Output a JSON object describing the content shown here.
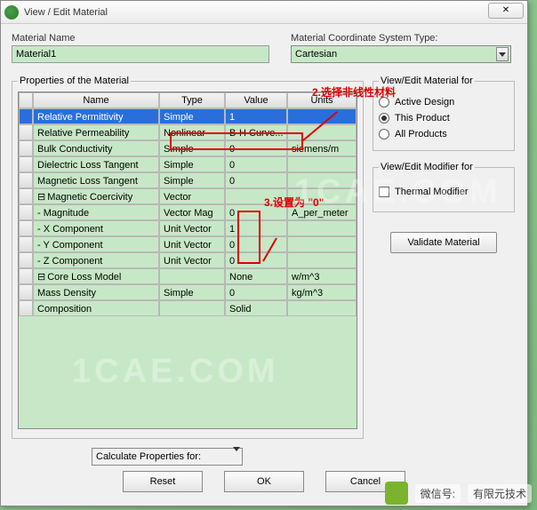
{
  "window": {
    "title": "View / Edit Material",
    "close": "✕"
  },
  "material_name": {
    "label": "Material Name",
    "value": "Material1"
  },
  "coord": {
    "label": "Material Coordinate System Type:",
    "value": "Cartesian"
  },
  "props": {
    "legend": "Properties of the Material",
    "headers": {
      "name": "Name",
      "type": "Type",
      "value": "Value",
      "units": "Units"
    },
    "rows": [
      {
        "name": "Relative Permittivity",
        "type": "Simple",
        "value": "1",
        "units": "",
        "selected": true
      },
      {
        "name": "Relative Permeability",
        "type": "Nonlinear",
        "value": "B-H Curve...",
        "units": ""
      },
      {
        "name": "Bulk Conductivity",
        "type": "Simple",
        "value": "0",
        "units": "siemens/m"
      },
      {
        "name": "Dielectric Loss Tangent",
        "type": "Simple",
        "value": "0",
        "units": ""
      },
      {
        "name": "Magnetic Loss Tangent",
        "type": "Simple",
        "value": "0",
        "units": ""
      },
      {
        "name": "Magnetic Coercivity",
        "type": "Vector",
        "value": "",
        "units": "",
        "minus": true
      },
      {
        "name": "- Magnitude",
        "type": "Vector Mag",
        "value": "0",
        "units": "A_per_meter"
      },
      {
        "name": "- X Component",
        "type": "Unit Vector",
        "value": "1",
        "units": ""
      },
      {
        "name": "- Y Component",
        "type": "Unit Vector",
        "value": "0",
        "units": ""
      },
      {
        "name": "- Z Component",
        "type": "Unit Vector",
        "value": "0",
        "units": ""
      },
      {
        "name": "Core Loss Model",
        "type": "",
        "value": "None",
        "units": "w/m^3",
        "minus": true
      },
      {
        "name": "Mass Density",
        "type": "Simple",
        "value": "0",
        "units": "kg/m^3"
      },
      {
        "name": "Composition",
        "type": "",
        "value": "Solid",
        "units": ""
      }
    ]
  },
  "view_edit": {
    "legend": "View/Edit Material for",
    "options": [
      "Active Design",
      "This Product",
      "All Products"
    ],
    "selected": 1
  },
  "modifier": {
    "legend": "View/Edit Modifier for",
    "check_label": "Thermal Modifier"
  },
  "validate": "Validate Material",
  "calc": "Calculate Properties for:",
  "buttons": {
    "reset": "Reset",
    "ok": "OK",
    "cancel": "Cancel"
  },
  "annotations": {
    "a2": "2.选择非线性材料",
    "a3": "3.设置为 \"0\""
  },
  "footer": {
    "wechat": "微信号:",
    "site": "有限元技术"
  },
  "watermark": "1CAE.COM"
}
